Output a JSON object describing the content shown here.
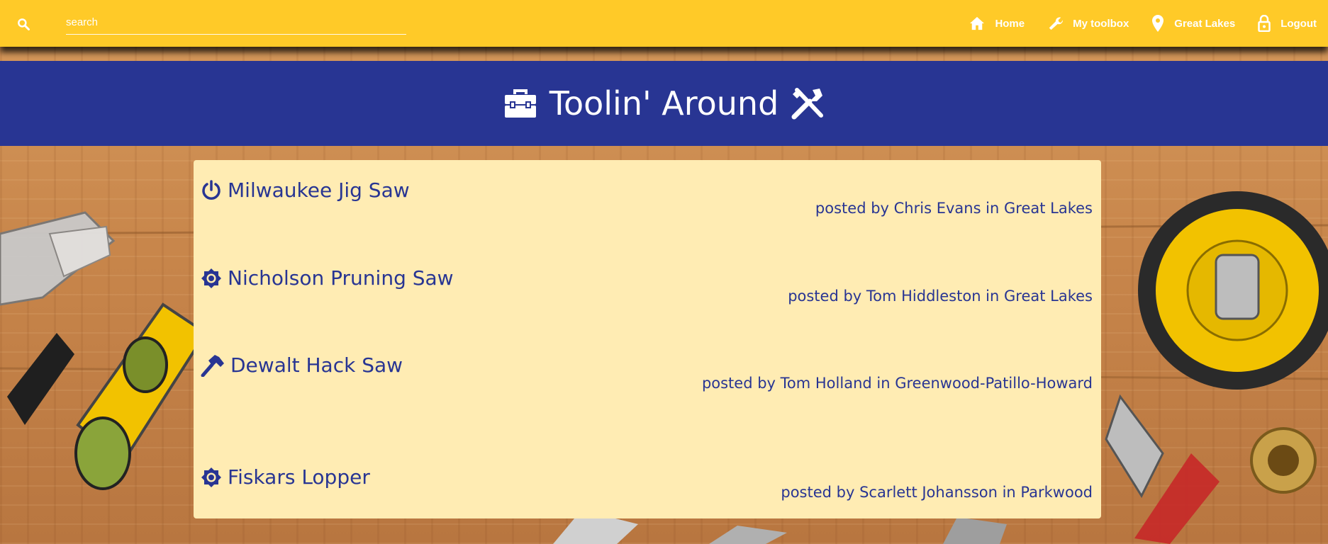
{
  "search": {
    "placeholder": "search"
  },
  "nav": {
    "home": "Home",
    "toolbox": "My toolbox",
    "location": "Great Lakes",
    "logout": "Logout"
  },
  "banner": {
    "title": "Toolin' Around"
  },
  "tools": [
    {
      "name": "Milwaukee Jig Saw",
      "posted": "posted by Chris Evans in Great Lakes",
      "icon": "power-icon"
    },
    {
      "name": "Nicholson Pruning Saw",
      "posted": "posted by Tom Hiddleston in Great Lakes",
      "icon": "brightness-icon"
    },
    {
      "name": "Dewalt Hack Saw",
      "posted": "posted by Tom Holland in Greenwood-Patillo-Howard",
      "icon": "hammer-icon"
    },
    {
      "name": "Fiskars Lopper",
      "posted": "posted by Scarlett Johansson in Parkwood",
      "icon": "brightness-icon"
    }
  ],
  "colors": {
    "appbar": "#ffca28",
    "banner": "#283593",
    "card": "#ffecb3",
    "text": "#283593"
  }
}
